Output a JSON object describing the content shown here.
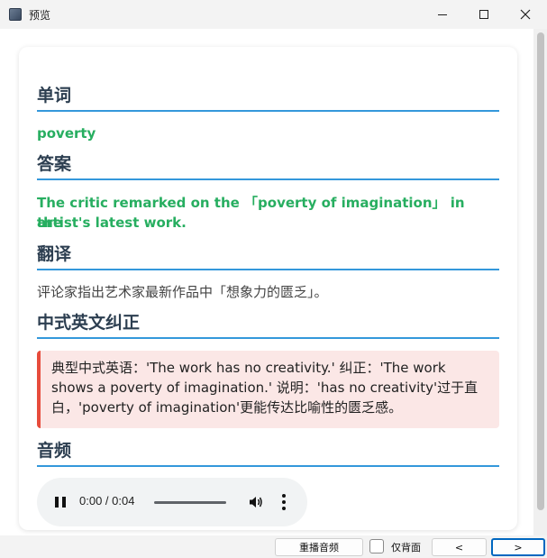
{
  "window": {
    "title": "预览"
  },
  "sections": {
    "word": {
      "heading": "单词",
      "value": "poverty"
    },
    "answer": {
      "heading": "答案",
      "line1": "The critic remarked on the 「poverty of imagination」 in the",
      "line2": "artist's latest work."
    },
    "translation": {
      "heading": "翻译",
      "value": "评论家指出艺术家最新作品中「想象力的匮乏」。"
    },
    "correction": {
      "heading": "中式英文纠正",
      "line1": "典型中式英语：'The work has no creativity.' 纠正：'The work",
      "line2": "shows a poverty of imagination.' 说明：'has no creativity'过于直",
      "line3": "白，'poverty of imagination'更能传达比喻性的匮乏感。"
    },
    "audio": {
      "heading": "音频",
      "time": "0:00 / 0:04",
      "progress": 0
    }
  },
  "bottombar": {
    "replay_label": "重播音频",
    "front_only_label": "仅背面",
    "prev_label": "<",
    "next_label": ">"
  },
  "colors": {
    "heading_underline": "#3498db",
    "green": "#27ae60",
    "correction_border": "#e74c3c",
    "correction_bg": "#fbe7e6"
  }
}
